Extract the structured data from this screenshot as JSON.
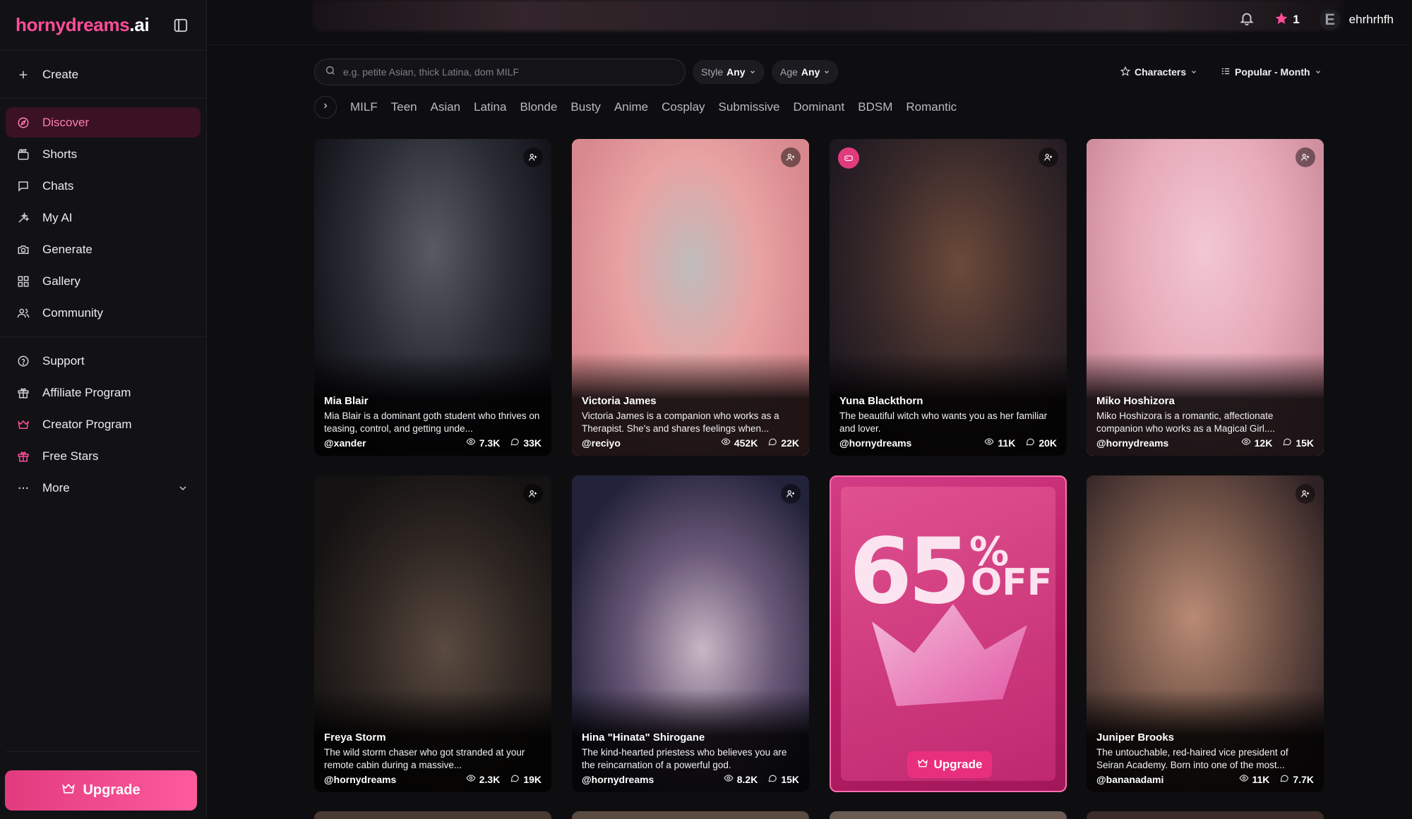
{
  "brand": {
    "part1": "hornydreams",
    "part2": ".ai"
  },
  "sidebar": {
    "primary": [
      {
        "label": "Create",
        "icon": "plus-icon"
      }
    ],
    "main": [
      {
        "label": "Discover",
        "icon": "compass-icon",
        "active": true
      },
      {
        "label": "Shorts",
        "icon": "clapperboard-icon"
      },
      {
        "label": "Chats",
        "icon": "chat-icon"
      },
      {
        "label": "My AI",
        "icon": "sparkle-icon"
      },
      {
        "label": "Generate",
        "icon": "camera-icon"
      },
      {
        "label": "Gallery",
        "icon": "grid-icon"
      },
      {
        "label": "Community",
        "icon": "users-icon"
      }
    ],
    "secondary": [
      {
        "label": "Support",
        "icon": "help-icon"
      },
      {
        "label": "Affiliate Program",
        "icon": "gift-icon"
      },
      {
        "label": "Creator Program",
        "icon": "crown-icon"
      },
      {
        "label": "Free Stars",
        "icon": "gift-icon"
      },
      {
        "label": "More",
        "icon": "ellipsis-icon"
      }
    ],
    "upgrade_label": "Upgrade"
  },
  "header": {
    "stars_count": "1",
    "avatar_initial": "E",
    "username": "ehrhrhfh"
  },
  "filters": {
    "search_placeholder": "e.g. petite Asian, thick Latina, dom MILF",
    "style_label": "Style",
    "style_value": "Any",
    "age_label": "Age",
    "age_value": "Any",
    "type_label": "Characters",
    "sort_label": "Popular - Month"
  },
  "tags": [
    "MILF",
    "Teen",
    "Asian",
    "Latina",
    "Blonde",
    "Busty",
    "Anime",
    "Cosplay",
    "Submissive",
    "Dominant",
    "BDSM",
    "Romantic"
  ],
  "cards": [
    {
      "name": "Mia Blair",
      "desc": "Mia Blair is a dominant goth student who thrives on teasing, control, and getting unde...",
      "author": "@xander",
      "views": "7.3K",
      "chats": "33K"
    },
    {
      "name": "Victoria James",
      "desc": "Victoria James is a companion who works as a Therapist. She's and shares feelings when...",
      "author": "@reciyo",
      "views": "452K",
      "chats": "22K"
    },
    {
      "name": "Yuna Blackthorn",
      "desc": "The beautiful witch who wants you as her familiar and lover.",
      "author": "@hornydreams",
      "views": "11K",
      "chats": "20K"
    },
    {
      "name": "Miko Hoshizora",
      "desc": "Miko Hoshizora is a romantic, affectionate companion who works as a Magical Girl....",
      "author": "@hornydreams",
      "views": "12K",
      "chats": "15K"
    },
    {
      "name": "Freya Storm",
      "desc": "The wild storm chaser who got stranded at your remote cabin during a massive...",
      "author": "@hornydreams",
      "views": "2.3K",
      "chats": "19K"
    },
    {
      "name": "Hina \"Hinata\" Shirogane",
      "desc": "The kind-hearted priestess who believes you are the reincarnation of a powerful god.",
      "author": "@hornydreams",
      "views": "8.2K",
      "chats": "15K"
    },
    {
      "name": "Juniper Brooks",
      "desc": "The untouchable, red-haired vice president of Seiran Academy. Born into one of the most...",
      "author": "@bananadami",
      "views": "11K",
      "chats": "7.7K"
    }
  ],
  "promo": {
    "number": "65",
    "percent": "%",
    "off": "OFF",
    "button": "Upgrade"
  },
  "colors": {
    "accent": "#ff4d9a",
    "active_bg": "#3a1224",
    "upgrade": "#e13b7e",
    "background": "#0e0e11"
  }
}
